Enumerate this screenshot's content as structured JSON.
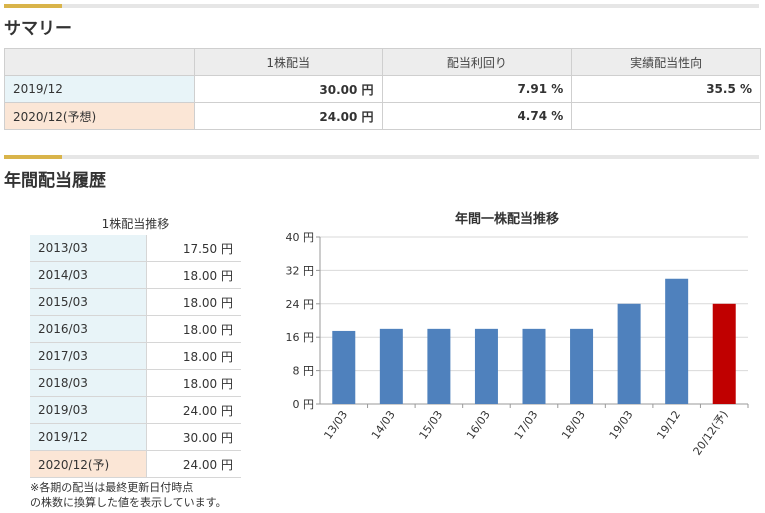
{
  "summary": {
    "title": "サマリー",
    "headers": [
      "",
      "1株配当",
      "配当利回り",
      "実績配当性向"
    ],
    "rows": [
      {
        "label": "2019/12",
        "dividend": "30.00 円",
        "yield": "7.91 %",
        "payout": "35.5 %"
      },
      {
        "label": "2020/12(予想)",
        "dividend": "24.00 円",
        "yield": "4.74 %",
        "payout": ""
      }
    ]
  },
  "history": {
    "title": "年間配当履歴",
    "table_caption": "1株配当推移",
    "rows": [
      {
        "period": "2013/03",
        "value": "17.50 円"
      },
      {
        "period": "2014/03",
        "value": "18.00 円"
      },
      {
        "period": "2015/03",
        "value": "18.00 円"
      },
      {
        "period": "2016/03",
        "value": "18.00 円"
      },
      {
        "period": "2017/03",
        "value": "18.00 円"
      },
      {
        "period": "2018/03",
        "value": "18.00 円"
      },
      {
        "period": "2019/03",
        "value": "24.00 円"
      },
      {
        "period": "2019/12",
        "value": "30.00 円"
      },
      {
        "period": "2020/12(予)",
        "value": "24.00 円"
      }
    ],
    "note_line1": "※各期の配当は最終更新日付時点",
    "note_line2": "の株数に換算した値を表示しています。"
  },
  "colors": {
    "accent": "#d9b44a",
    "bar": "#4f81bd",
    "forecast_bar": "#c00000",
    "row_label_bg": "#e8f4f8",
    "forecast_label_bg": "#fbe6d6"
  },
  "chart_data": {
    "type": "bar",
    "title": "年間一株配当推移",
    "categories": [
      "13/03",
      "14/03",
      "15/03",
      "16/03",
      "17/03",
      "18/03",
      "19/03",
      "19/12",
      "20/12(予)"
    ],
    "values": [
      17.5,
      18,
      18,
      18,
      18,
      18,
      24,
      30,
      24
    ],
    "forecast_index": 8,
    "ylim": [
      0,
      40
    ],
    "yticks": [
      0,
      8,
      16,
      24,
      32,
      40
    ],
    "ytick_labels": [
      "0 円",
      "8 円",
      "16 円",
      "24 円",
      "32 円",
      "40 円"
    ],
    "grid": "horizontal",
    "legend": "none",
    "xlabel": "",
    "ylabel": ""
  }
}
